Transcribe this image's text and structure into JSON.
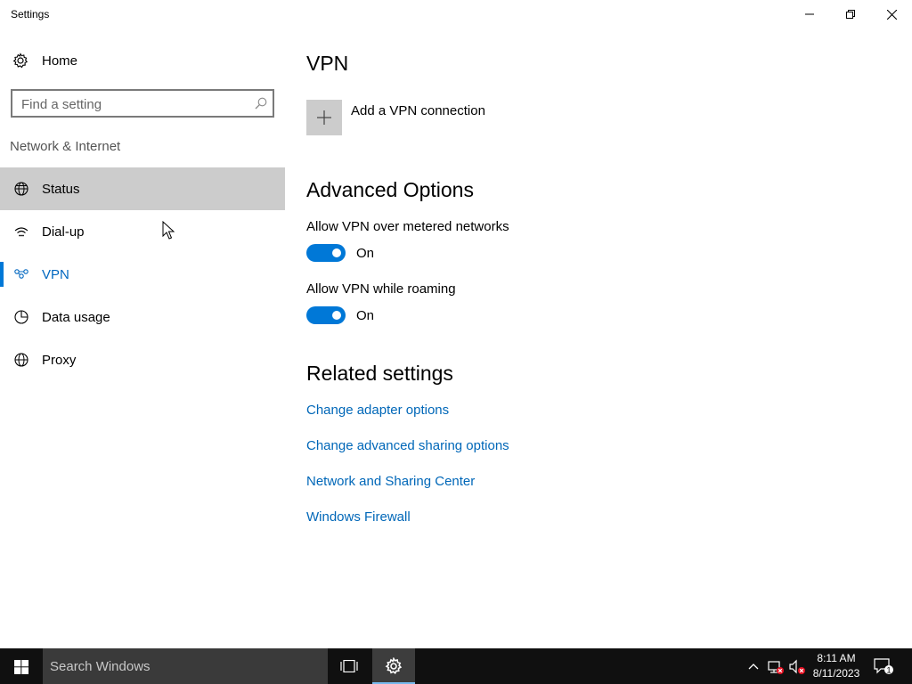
{
  "window": {
    "title": "Settings"
  },
  "sidebar": {
    "home_label": "Home",
    "search_placeholder": "Find a setting",
    "section_title": "Network & Internet",
    "items": [
      {
        "label": "Status",
        "icon": "globe-status-icon"
      },
      {
        "label": "Dial-up",
        "icon": "dialup-icon"
      },
      {
        "label": "VPN",
        "icon": "vpn-icon"
      },
      {
        "label": "Data usage",
        "icon": "data-usage-icon"
      },
      {
        "label": "Proxy",
        "icon": "proxy-globe-icon"
      }
    ],
    "selected": "VPN",
    "hovered": "Status"
  },
  "main": {
    "title": "VPN",
    "add_vpn_label": "Add a VPN connection",
    "advanced_title": "Advanced Options",
    "options": [
      {
        "label": "Allow VPN over metered networks",
        "state": "On",
        "on": true
      },
      {
        "label": "Allow VPN while roaming",
        "state": "On",
        "on": true
      }
    ],
    "related_title": "Related settings",
    "links": [
      "Change adapter options",
      "Change advanced sharing options",
      "Network and Sharing Center",
      "Windows Firewall"
    ]
  },
  "taskbar": {
    "search_text": "Search Windows",
    "time": "8:11 AM",
    "date": "8/11/2023",
    "notification_count": "1"
  },
  "colors": {
    "accent": "#0078d7",
    "link": "#0067b8",
    "hover": "#cccccc",
    "taskbar": "#101010"
  }
}
